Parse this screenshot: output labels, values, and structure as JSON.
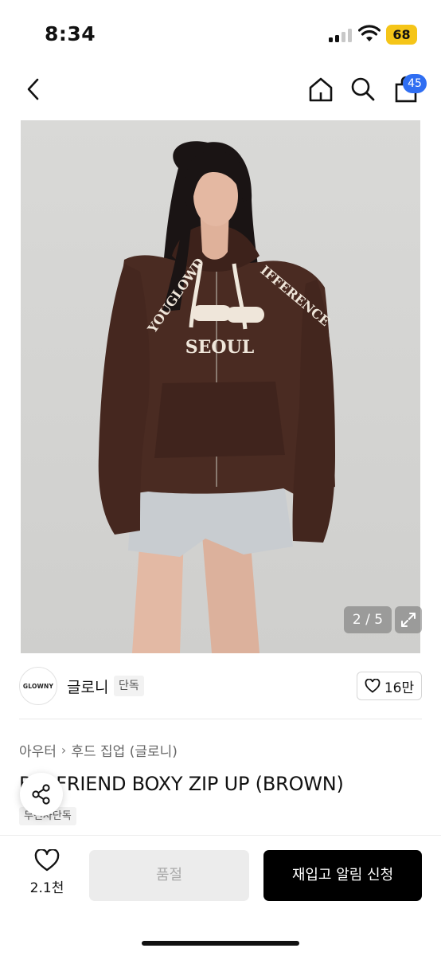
{
  "status_bar": {
    "time": "8:34",
    "battery": "68"
  },
  "nav": {
    "cart_badge": "45"
  },
  "product_image": {
    "counter": "2 / 5",
    "hoodie_text": "SEOUL",
    "hoodie_arch_left": "YOUGLOWD",
    "hoodie_arch_right": "IFFERENCE"
  },
  "brand": {
    "logo_text": "GLOWNY",
    "name": "글로니",
    "tag": "단독",
    "likes": "16만"
  },
  "breadcrumb": {
    "category": "아우터",
    "subcategory": "후드 집업 (글로니)"
  },
  "product": {
    "title": "BOYFRIEND BOXY ZIP UP (BROWN)",
    "title_visible_prefix": "B",
    "title_visible_rest": "FRIEND BOXY ZIP UP (BROWN)",
    "exclusive_badge": "무신사단독"
  },
  "bottom_bar": {
    "wish_count": "2.1천",
    "soldout_label": "품절",
    "restock_label": "재입고 알림 신청"
  },
  "colors": {
    "accent": "#2f6ef2",
    "battery": "#f5c518",
    "hoodie": "#4a2b22",
    "primary_button": "#000000"
  }
}
